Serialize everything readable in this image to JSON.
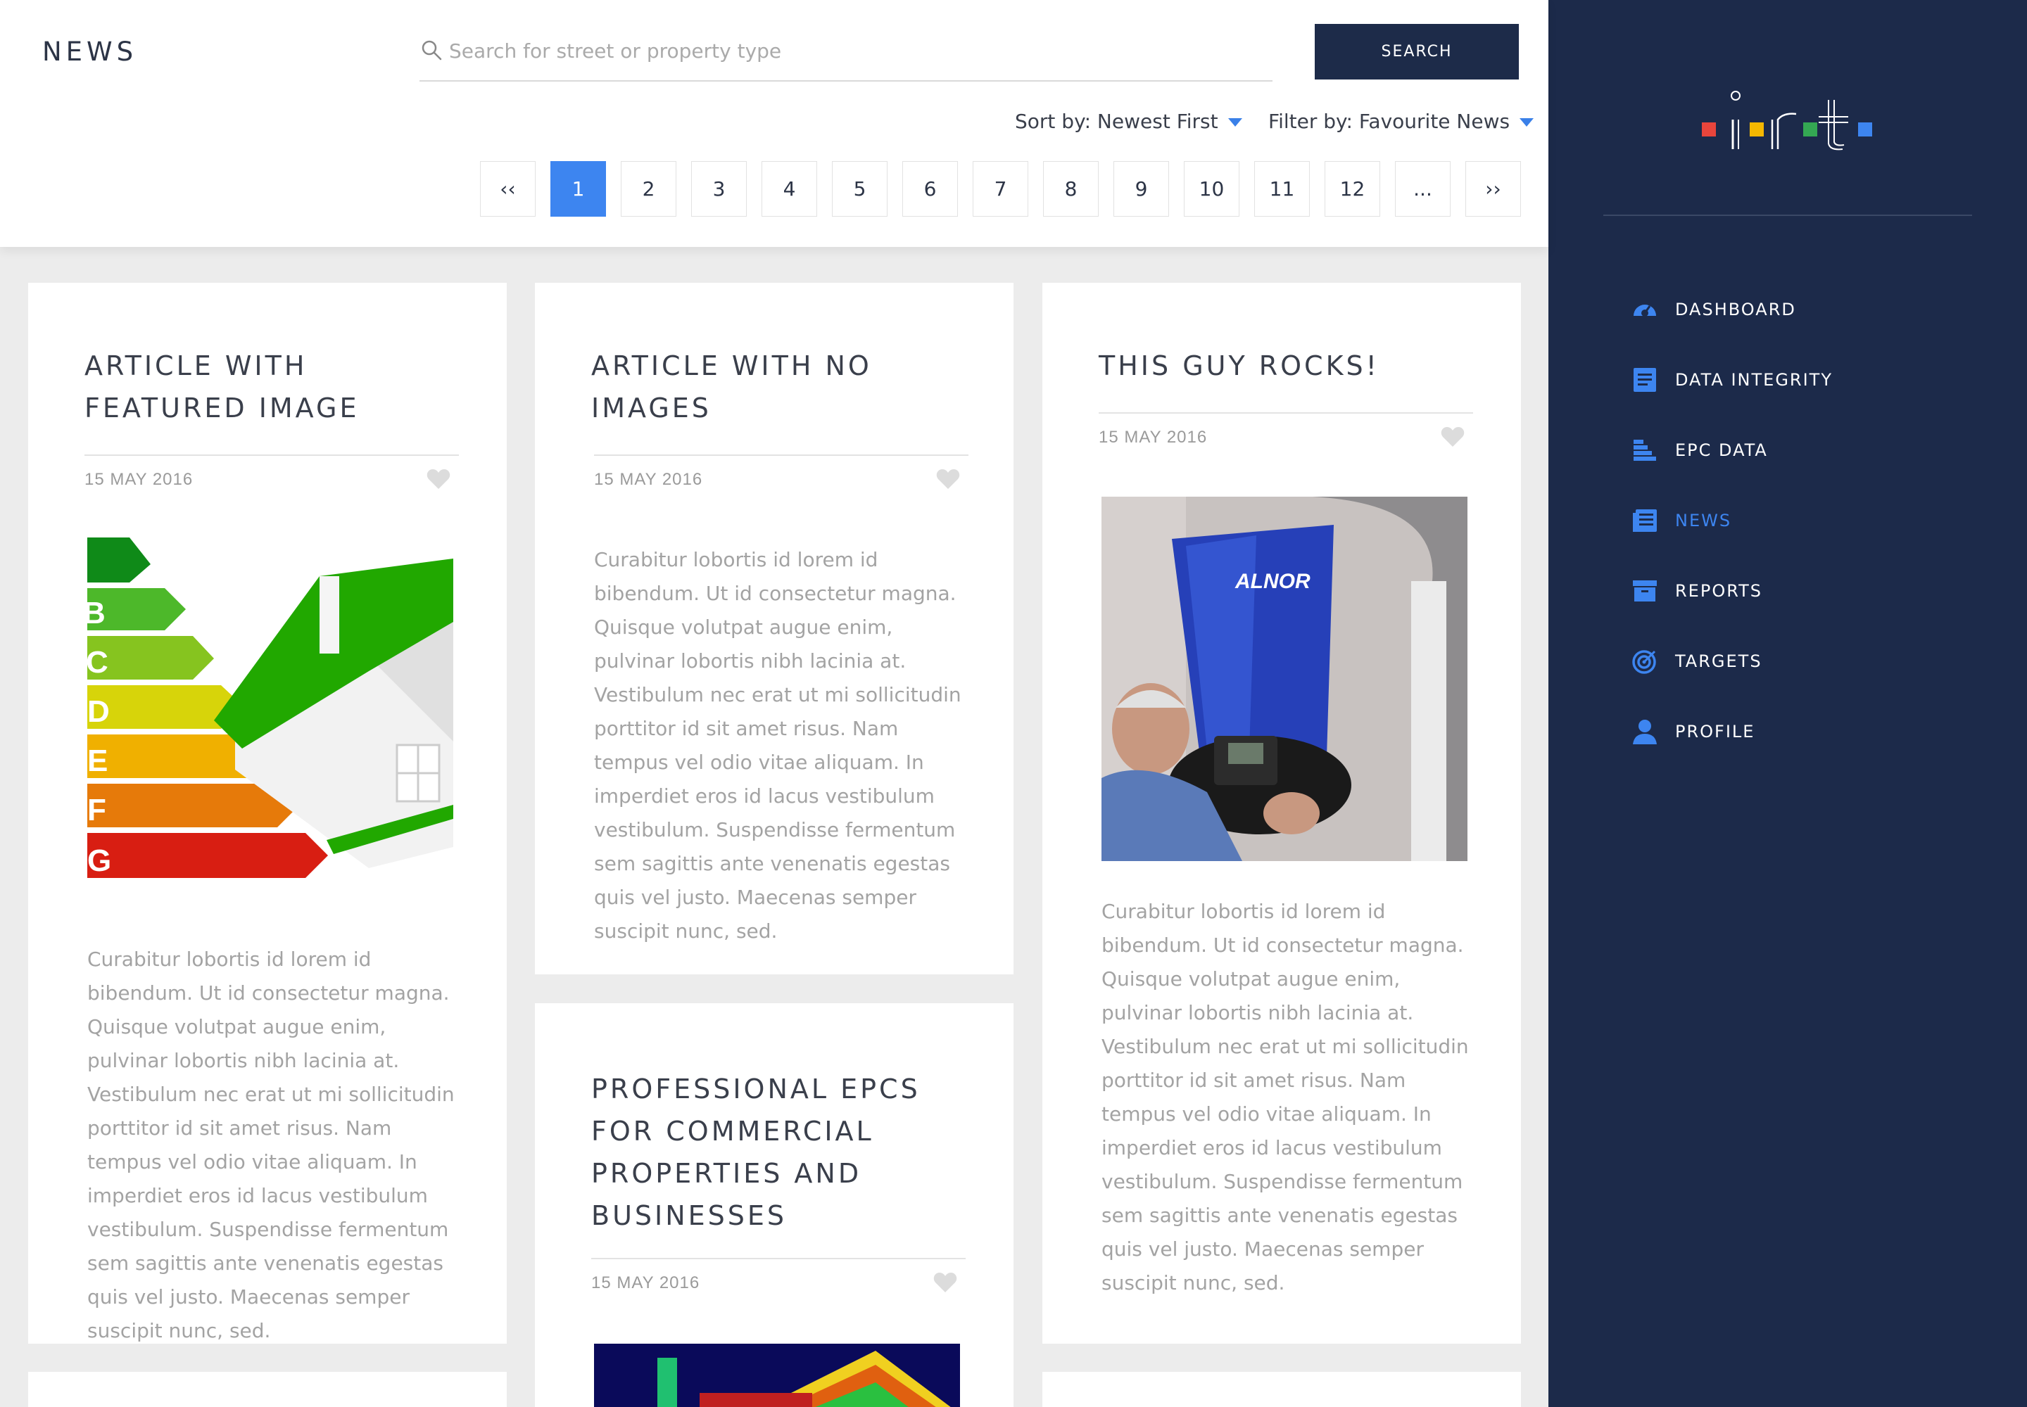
{
  "header": {
    "title": "NEWS",
    "search_placeholder": "Search for street or property type",
    "search_button": "SEARCH",
    "sort_label": "Sort by: Newest First",
    "filter_label": "Filter by: Favourite News"
  },
  "pagination": {
    "first": "‹‹",
    "pages": [
      "1",
      "2",
      "3",
      "4",
      "5",
      "6",
      "7",
      "8",
      "9",
      "10",
      "11",
      "12"
    ],
    "ellipsis": "...",
    "last": "››",
    "active_page": "1"
  },
  "sidebar": {
    "items": [
      {
        "label": "DASHBOARD",
        "icon": "dashboard-icon"
      },
      {
        "label": "DATA INTEGRITY",
        "icon": "document-icon"
      },
      {
        "label": "EPC DATA",
        "icon": "epc-chart-icon"
      },
      {
        "label": "NEWS",
        "icon": "newspaper-icon",
        "active": true
      },
      {
        "label": "REPORTS",
        "icon": "archive-box-icon"
      },
      {
        "label": "TARGETS",
        "icon": "target-icon"
      },
      {
        "label": "PROFILE",
        "icon": "user-icon"
      }
    ]
  },
  "cards": [
    {
      "title_lines": [
        "ARTICLE WITH",
        "FEATURED IMAGE"
      ],
      "date": "15 MAY 2016",
      "image": "epc-energy-rating-house",
      "image_letters": [
        "B",
        "C",
        "D",
        "E",
        "F",
        "G"
      ],
      "body": "Curabitur lobortis id lorem id bibendum. Ut id consectetur magna. Quisque volutpat augue enim, pulvinar lobortis nibh lacinia at. Vestibulum nec erat ut mi sollicitudin porttitor id sit amet risus. Nam tempus vel odio vitae aliquam. In imperdiet eros id lacus vestibulum vestibulum. Suspendisse fermentum sem sagittis ante venenatis egestas quis vel justo. Maecenas semper suscipit nunc, sed."
    },
    {
      "title_lines": [
        "ARTICLE WITH NO",
        "IMAGES"
      ],
      "date": "15 MAY 2016",
      "body": "Curabitur lobortis id lorem id bibendum. Ut id consectetur magna. Quisque volutpat augue enim, pulvinar lobortis nibh lacinia at. Vestibulum nec erat ut mi sollicitudin porttitor id sit amet risus. Nam tempus vel odio vitae aliquam. In imperdiet eros id lacus vestibulum vestibulum. Suspendisse fermentum sem sagittis ante venenatis egestas quis vel justo. Maecenas semper suscipit nunc, sed."
    },
    {
      "title_lines": [
        "THIS GUY ROCKS!"
      ],
      "date": "15 MAY 2016",
      "image": "man-with-alnor-blower-door",
      "image_brand": "ALNOR",
      "body": "Curabitur lobortis id lorem id bibendum. Ut id consectetur magna. Quisque volutpat augue enim, pulvinar lobortis nibh lacinia at. Vestibulum nec erat ut mi sollicitudin porttitor id sit amet risus. Nam tempus vel odio vitae aliquam. In imperdiet eros id lacus vestibulum vestibulum. Suspendisse fermentum sem sagittis ante venenatis egestas quis vel justo. Maecenas semper suscipit nunc, sed."
    },
    {
      "title_lines": [
        "PROFESSIONAL EPCS",
        "FOR COMMERCIAL",
        "PROPERTIES AND",
        "BUSINESSES"
      ],
      "date": "15 MAY 2016",
      "image": "thermal-house-image"
    }
  ],
  "colors": {
    "sidebar_bg": "#1c2a4a",
    "accent": "#3d85f0",
    "logo_red": "#e8453c",
    "logo_yellow": "#f5b800",
    "logo_green": "#34a853",
    "logo_blue": "#3d85f0"
  }
}
